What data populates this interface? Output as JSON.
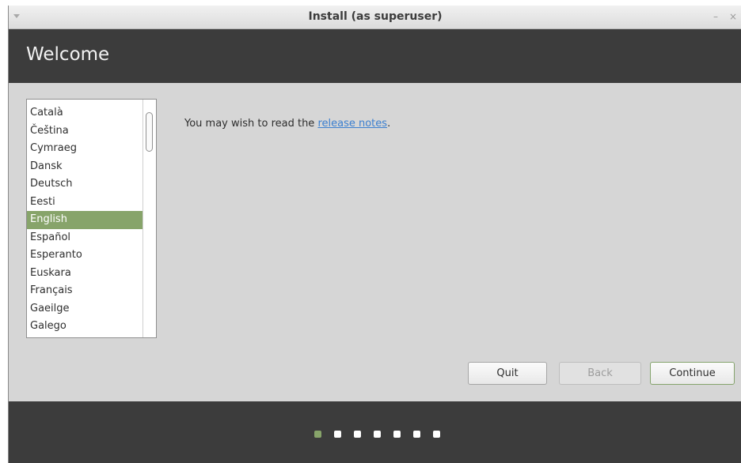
{
  "window": {
    "title": "Install (as superuser)",
    "minimize_glyph": "–",
    "close_glyph": "×"
  },
  "header": {
    "title": "Welcome"
  },
  "languages": {
    "items": [
      "Català",
      "Čeština",
      "Cymraeg",
      "Dansk",
      "Deutsch",
      "Eesti",
      "English",
      "Español",
      "Esperanto",
      "Euskara",
      "Français",
      "Gaeilge",
      "Galego"
    ],
    "selected": "English"
  },
  "notes": {
    "prefix": "You may wish to read the ",
    "link": "release notes",
    "suffix": "."
  },
  "buttons": {
    "quit": "Quit",
    "back": "Back",
    "continue": "Continue"
  },
  "progress": {
    "total_steps": 7,
    "current_step": 1
  },
  "colors": {
    "accent": "#87a46a",
    "header_bg": "#3c3c3c",
    "link": "#3b7fd0"
  }
}
